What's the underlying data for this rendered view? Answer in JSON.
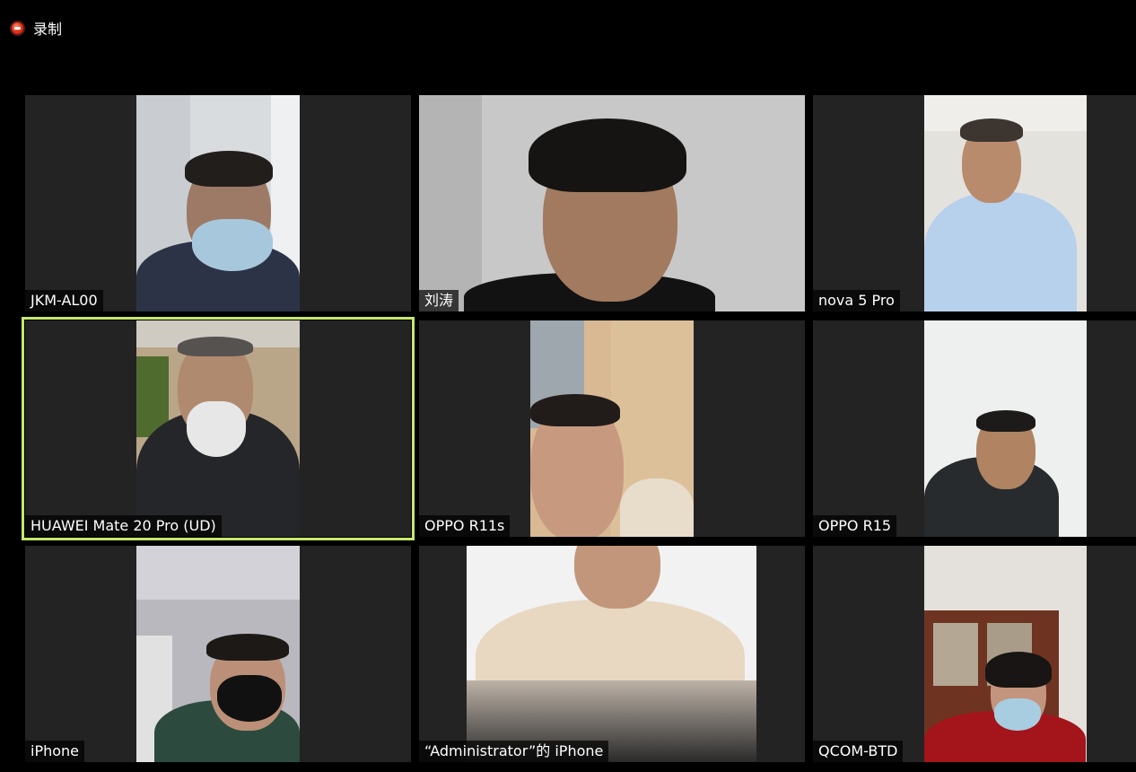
{
  "recording": {
    "icon": "recording-icon",
    "label": "录制",
    "color": "#e83a1f"
  },
  "gallery": {
    "active_color": "#c5e86c",
    "participants": [
      {
        "name": "JKM-AL00",
        "video_on": true,
        "mask": "surgical",
        "active": false
      },
      {
        "name": "刘涛",
        "video_on": true,
        "mask": "none",
        "active": false
      },
      {
        "name": "nova 5 Pro",
        "video_on": true,
        "mask": "none",
        "active": false
      },
      {
        "name": "HUAWEI Mate 20 Pro (UD)",
        "video_on": true,
        "mask": "respirator",
        "active": true
      },
      {
        "name": "OPPO R11s",
        "video_on": true,
        "mask": "none",
        "active": false
      },
      {
        "name": "OPPO R15",
        "video_on": true,
        "mask": "none",
        "active": false
      },
      {
        "name": "iPhone",
        "video_on": true,
        "mask": "black",
        "active": false
      },
      {
        "name": "“Administrator”的 iPhone",
        "video_on": true,
        "mask": "none",
        "active": false
      },
      {
        "name": "QCOM-BTD",
        "video_on": true,
        "mask": "surgical",
        "active": false
      }
    ]
  }
}
